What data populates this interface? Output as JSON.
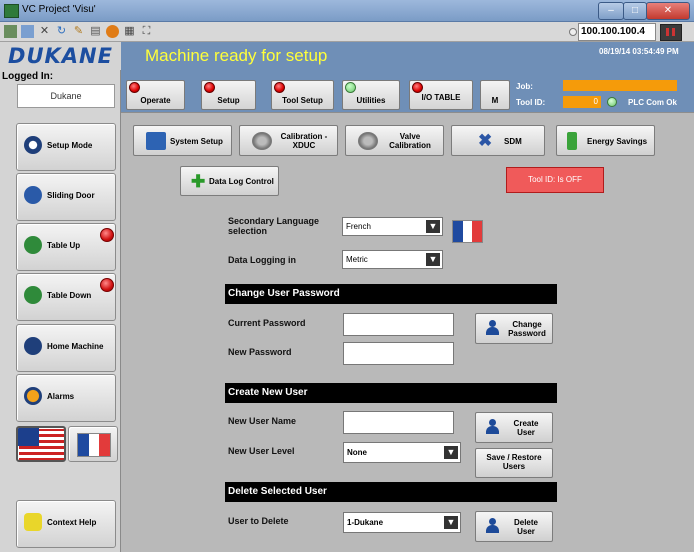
{
  "window": {
    "title": "VC Project 'Visu'",
    "ip": "100.100.100.4"
  },
  "brand": {
    "logo": "DUKANE"
  },
  "header": {
    "message": "Machine ready for setup",
    "datetime": "08/19/14 03:54:49 PM"
  },
  "login": {
    "label": "Logged In:",
    "user": "Dukane"
  },
  "top_buttons": [
    {
      "label": "Operate",
      "status": "red"
    },
    {
      "label": "Setup",
      "status": "red"
    },
    {
      "label": "Tool Setup",
      "status": "red"
    },
    {
      "label": "Utilities",
      "status": "green"
    },
    {
      "label": "I/O TABLE",
      "status": "red"
    },
    {
      "label": "M",
      "status": "none"
    }
  ],
  "job": {
    "job_label": "Job:",
    "tool_label": "Tool ID:",
    "tool_value": "0",
    "plc_status": "PLC Com Ok"
  },
  "left_buttons": [
    {
      "label": "Setup Mode"
    },
    {
      "label": "Sliding Door"
    },
    {
      "label": "Table Up"
    },
    {
      "label": "Table Down"
    },
    {
      "label": "Home Machine"
    },
    {
      "label": "Alarms"
    },
    {
      "label": "Context Help"
    }
  ],
  "tool_buttons": [
    {
      "label": "System Setup"
    },
    {
      "label": "Calibration - XDUC"
    },
    {
      "label": "Valve Calibration"
    },
    {
      "label": "SDM"
    },
    {
      "label": "Energy Savings"
    },
    {
      "label": "Data Log Control"
    }
  ],
  "tool_id_status": "Tool ID: Is OFF",
  "settings": {
    "secondary_language_label": "Secondary Language selection",
    "secondary_language_value": "French",
    "data_logging_label": "Data Logging in",
    "data_logging_value": "Metric"
  },
  "change_password": {
    "title": "Change User Password",
    "current_label": "Current Password",
    "new_label": "New Password",
    "button": "Change Password"
  },
  "create_user": {
    "title": "Create New User",
    "name_label": "New User Name",
    "level_label": "New User Level",
    "level_value": "None",
    "create_button": "Create User",
    "save_restore_button": "Save / Restore Users"
  },
  "delete_user": {
    "title": "Delete Selected User",
    "label": "User to Delete",
    "value": "1-Dukane",
    "button": "Delete User"
  },
  "colors": {
    "accent": "#6f8fb7",
    "status_red": "#d01010",
    "status_green": "#6cc86c",
    "warning_orange": "#f59b0a"
  }
}
